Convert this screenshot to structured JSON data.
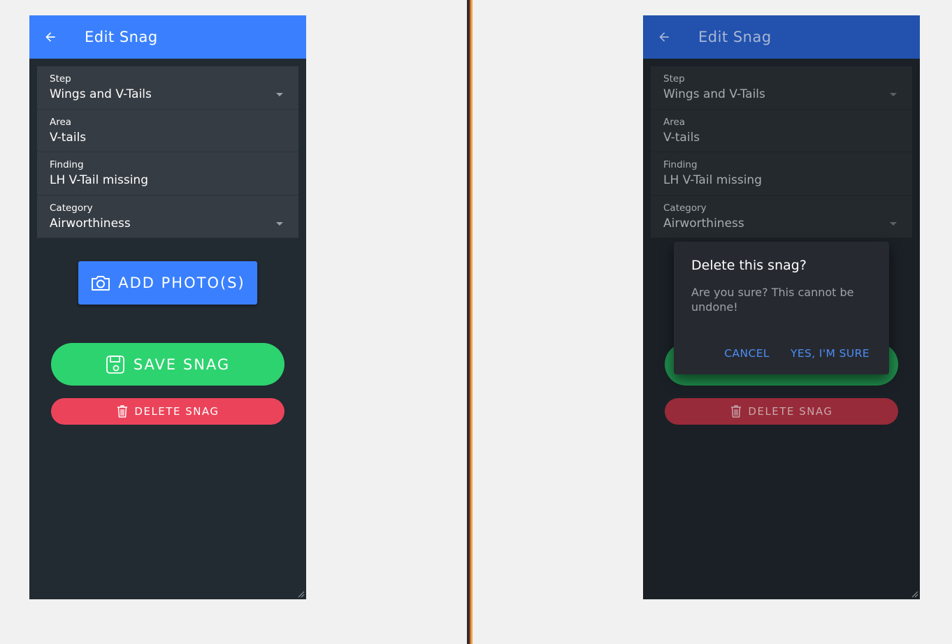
{
  "colors": {
    "primary": "#3a80fe",
    "success": "#2dd36f",
    "danger": "#eb445a",
    "background": "#222a32"
  },
  "screens": {
    "left": {
      "header": {
        "title": "Edit Snag"
      },
      "fields": [
        {
          "label": "Step",
          "value": "Wings and V-Tails",
          "dropdown": true
        },
        {
          "label": "Area",
          "value": "V-tails",
          "dropdown": false
        },
        {
          "label": "Finding",
          "value": "LH V-Tail missing",
          "dropdown": false
        },
        {
          "label": "Category",
          "value": "Airworthiness",
          "dropdown": true
        }
      ],
      "buttons": {
        "add_photo": "ADD PHOTO(S)",
        "save": "SAVE SNAG",
        "delete": "DELETE SNAG"
      }
    },
    "right": {
      "header": {
        "title": "Edit Snag"
      },
      "fields": [
        {
          "label": "Step",
          "value": "Wings and V-Tails",
          "dropdown": true
        },
        {
          "label": "Area",
          "value": "V-tails",
          "dropdown": false
        },
        {
          "label": "Finding",
          "value": "LH V-Tail missing",
          "dropdown": false
        },
        {
          "label": "Category",
          "value": "Airworthiness",
          "dropdown": true
        }
      ],
      "buttons": {
        "delete": "DELETE SNAG"
      },
      "dialog": {
        "title": "Delete this snag?",
        "message": "Are you sure? This cannot be undone!",
        "cancel": "CANCEL",
        "confirm": "YES, I'M SURE"
      }
    }
  },
  "icons": [
    "arrow-back-icon",
    "camera-icon",
    "save-icon",
    "trash-icon",
    "caret-down-icon",
    "resize-grip-icon"
  ]
}
